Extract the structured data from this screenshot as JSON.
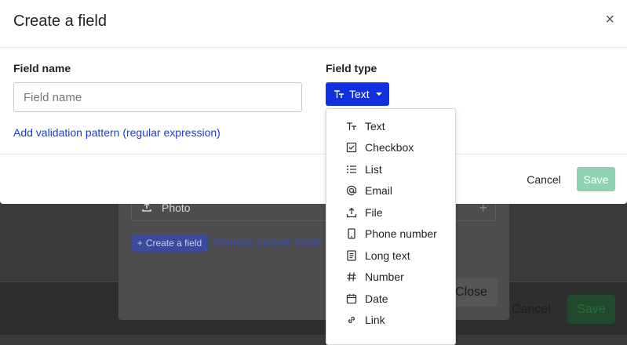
{
  "background": {
    "photo_label": "Photo",
    "create_field_label": "Create a field",
    "manage_link": "Manage custom fields",
    "close_label": "Close",
    "cancel_label": "Cancel",
    "save_label": "Save"
  },
  "modal": {
    "title": "Create a field",
    "close_symbol": "×",
    "field_name_label": "Field name",
    "field_name_placeholder": "Field name",
    "field_name_value": "",
    "validation_link": "Add validation pattern (regular expression)",
    "field_type_label": "Field type",
    "field_type_selected": "Text",
    "cancel_label": "Cancel",
    "save_label": "Save"
  },
  "dropdown": {
    "items": [
      {
        "label": "Text",
        "icon": "text-icon"
      },
      {
        "label": "Checkbox",
        "icon": "checkbox-icon"
      },
      {
        "label": "List",
        "icon": "list-icon"
      },
      {
        "label": "Email",
        "icon": "at-icon"
      },
      {
        "label": "File",
        "icon": "upload-icon"
      },
      {
        "label": "Phone number",
        "icon": "phone-icon"
      },
      {
        "label": "Long text",
        "icon": "document-icon"
      },
      {
        "label": "Number",
        "icon": "hash-icon"
      },
      {
        "label": "Date",
        "icon": "calendar-icon"
      },
      {
        "label": "Link",
        "icon": "link-icon"
      }
    ]
  },
  "colors": {
    "primary": "#1030e0",
    "link": "#1a3ec8",
    "save_disabled": "#8fd1b0"
  }
}
